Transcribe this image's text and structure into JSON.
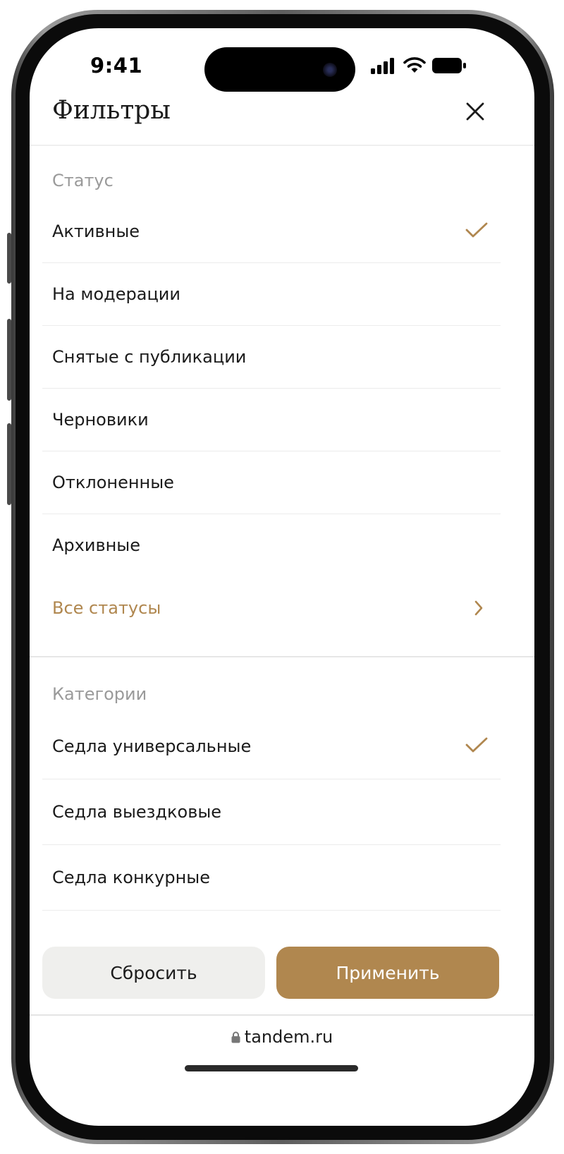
{
  "status_bar": {
    "time": "9:41"
  },
  "header": {
    "title": "Фильтры"
  },
  "status_section": {
    "label": "Статус",
    "items": [
      {
        "label": "Активные",
        "checked": true
      },
      {
        "label": "На модерации",
        "checked": false
      },
      {
        "label": "Снятые с публикации",
        "checked": false
      },
      {
        "label": "Черновики",
        "checked": false
      },
      {
        "label": "Отклоненные",
        "checked": false
      },
      {
        "label": "Архивные",
        "checked": false
      }
    ],
    "all_link": "Все статусы"
  },
  "categories_section": {
    "label": "Категории",
    "items": [
      {
        "label": "Седла универсальные",
        "checked": true
      },
      {
        "label": "Седла выездковые",
        "checked": false
      },
      {
        "label": "Седла конкурные",
        "checked": false
      }
    ]
  },
  "actions": {
    "reset_label": "Сбросить",
    "apply_label": "Применить"
  },
  "browser": {
    "url": "tandem.ru"
  },
  "colors": {
    "accent": "#b0874f",
    "reset_bg": "#efefed",
    "text": "#1b1b1b",
    "muted": "#9a9a9a"
  }
}
